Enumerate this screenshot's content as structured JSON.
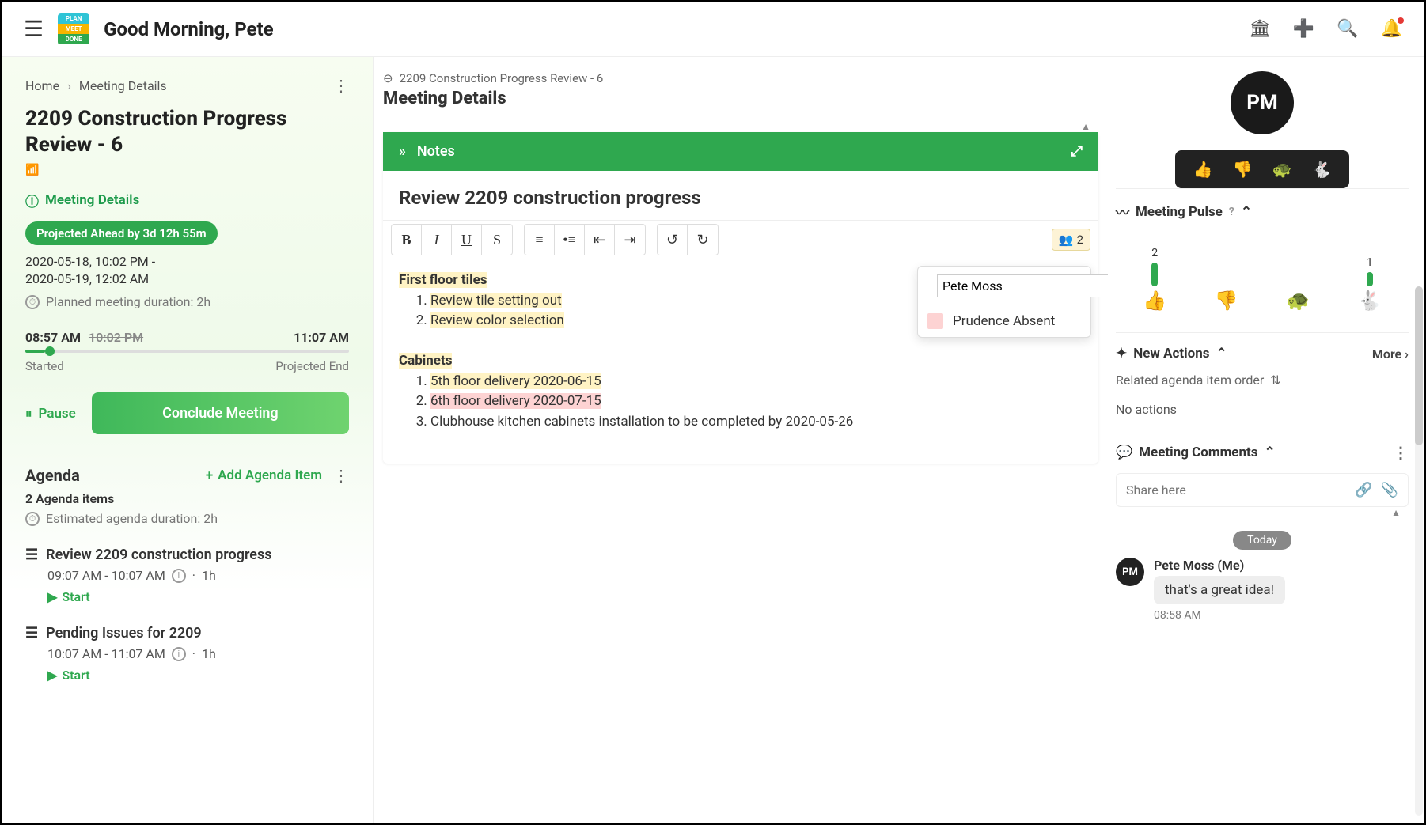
{
  "topbar": {
    "greeting": "Good Morning, Pete",
    "logo": {
      "line1": "PLAN",
      "line2": "MEET",
      "line3": "DONE"
    }
  },
  "sidebar": {
    "breadcrumb": {
      "home": "Home",
      "current": "Meeting Details"
    },
    "meeting_title": "2209 Construction Progress Review - 6",
    "details_link": "Meeting Details",
    "projected_badge": "Projected Ahead by 3d 12h 55m",
    "date_line1": "2020-05-18, 10:02 PM -",
    "date_line2": "2020-05-19, 12:02 AM",
    "planned_duration": "Planned meeting duration: 2h",
    "timeline": {
      "start_time": "08:57 AM",
      "struck_time": "10:02 PM",
      "end_time": "11:07 AM",
      "start_label": "Started",
      "end_label": "Projected End"
    },
    "pause_label": "Pause",
    "conclude_label": "Conclude Meeting",
    "agenda": {
      "heading": "Agenda",
      "add_label": "Add Agenda Item",
      "count_label": "2 Agenda items",
      "est_label": "Estimated agenda duration: 2h",
      "items": [
        {
          "title": "Review 2209 construction progress",
          "time": "09:07 AM - 10:07 AM",
          "duration": "1h",
          "start": "Start"
        },
        {
          "title": "Pending Issues for 2209",
          "time": "10:07 AM - 11:07 AM",
          "duration": "1h",
          "start": "Start"
        }
      ]
    }
  },
  "main": {
    "breadcrumb": "2209 Construction Progress Review - 6",
    "page_title": "Meeting Details",
    "notes": {
      "header": "Notes",
      "title": "Review 2209 construction progress",
      "presence_count": "2",
      "section1_head": "First floor tiles",
      "section1_item1": "Review tile setting out",
      "section1_item2": "Review color selection",
      "section2_head": "Cabinets",
      "section2_item1": "5th floor delivery 2020-06-15",
      "section2_item2": "6th floor delivery 2020-07-15",
      "section2_item3": "Clubhouse kitchen cabinets installation to be completed by 2020-05-26",
      "presence_users": [
        {
          "name": "Pete Moss",
          "color": "#fff3c4"
        },
        {
          "name": "Prudence Absent",
          "color": "#fdd3d3"
        }
      ]
    }
  },
  "right": {
    "avatar_initials": "PM",
    "pulse": {
      "heading": "Meeting Pulse",
      "cols": [
        {
          "count": "2",
          "bar": 30,
          "emoji": "👍"
        },
        {
          "count": "",
          "bar": 0,
          "emoji": "👎"
        },
        {
          "count": "",
          "bar": 0,
          "emoji": "🐢"
        },
        {
          "count": "1",
          "bar": 18,
          "emoji": "🐇"
        }
      ]
    },
    "actions": {
      "heading": "New Actions",
      "more": "More",
      "order_label": "Related agenda item order",
      "empty": "No actions"
    },
    "comments": {
      "heading": "Meeting Comments",
      "placeholder": "Share here",
      "today": "Today",
      "thread": [
        {
          "initials": "PM",
          "who": "Pete Moss (Me)",
          "text": "that's a great idea!",
          "when": "08:58 AM"
        }
      ]
    }
  }
}
